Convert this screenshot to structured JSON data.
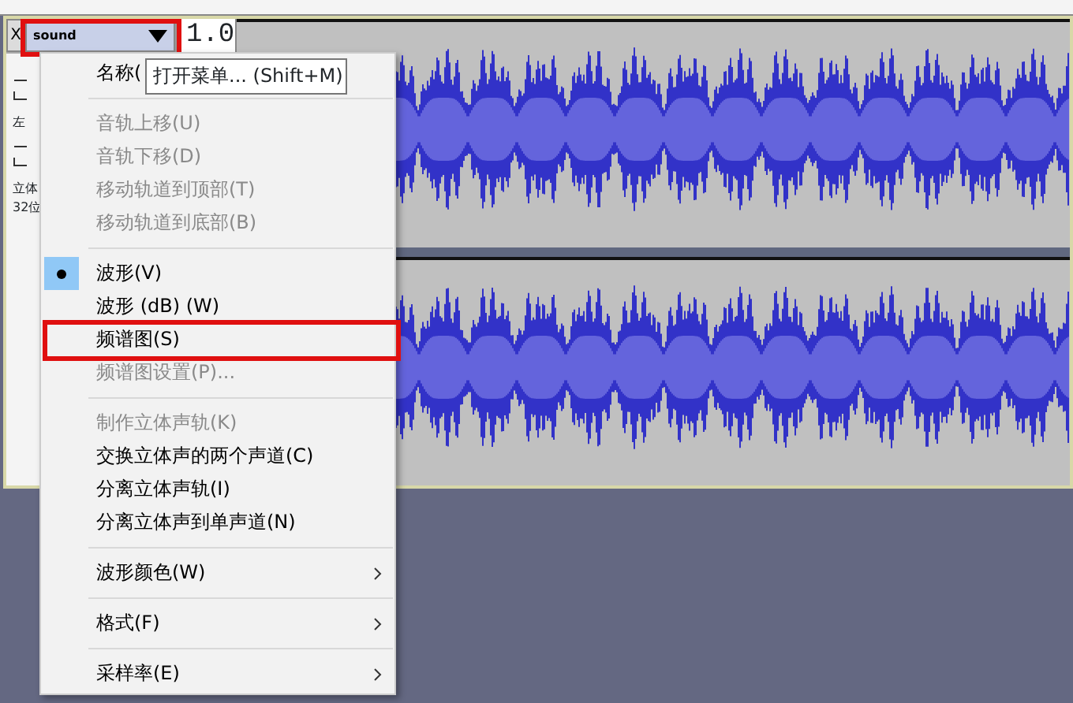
{
  "track": {
    "close_label": "X",
    "name": "sound",
    "name_highlighted": true,
    "scale_label": "1.0",
    "channel_label": "左",
    "info_lines": [
      "立体",
      "32位"
    ]
  },
  "menu": {
    "items": [
      {
        "kind": "item",
        "label": "名称(",
        "disabled": false
      },
      {
        "kind": "separator"
      },
      {
        "kind": "item",
        "label": "音轨上移(U)",
        "disabled": true
      },
      {
        "kind": "item",
        "label": "音轨下移(D)",
        "disabled": true
      },
      {
        "kind": "item",
        "label": "移动轨道到顶部(T)",
        "disabled": true
      },
      {
        "kind": "item",
        "label": "移动轨道到底部(B)",
        "disabled": true
      },
      {
        "kind": "separator"
      },
      {
        "kind": "item",
        "label": "波形(V)",
        "disabled": false,
        "selected": true
      },
      {
        "kind": "item",
        "label": "波形 (dB) (W)",
        "disabled": false,
        "selected": false
      },
      {
        "kind": "item",
        "label": "频谱图(S)",
        "disabled": false,
        "selected": false,
        "highlighted": true
      },
      {
        "kind": "item",
        "label": "频谱图设置(P)...",
        "disabled": true
      },
      {
        "kind": "separator"
      },
      {
        "kind": "item",
        "label": "制作立体声轨(K)",
        "disabled": true
      },
      {
        "kind": "item",
        "label": "交换立体声的两个声道(C)",
        "disabled": false
      },
      {
        "kind": "item",
        "label": "分离立体声轨(I)",
        "disabled": false
      },
      {
        "kind": "item",
        "label": "分离立体声到单声道(N)",
        "disabled": false
      },
      {
        "kind": "separator"
      },
      {
        "kind": "item",
        "label": "波形颜色(W)",
        "disabled": false,
        "submenu": true
      },
      {
        "kind": "separator"
      },
      {
        "kind": "item",
        "label": "格式(F)",
        "disabled": false,
        "submenu": true
      },
      {
        "kind": "separator"
      },
      {
        "kind": "item",
        "label": "采样率(E)",
        "disabled": false,
        "submenu": true
      }
    ]
  },
  "tooltip": {
    "text": "打开菜单... (Shift+M)"
  }
}
